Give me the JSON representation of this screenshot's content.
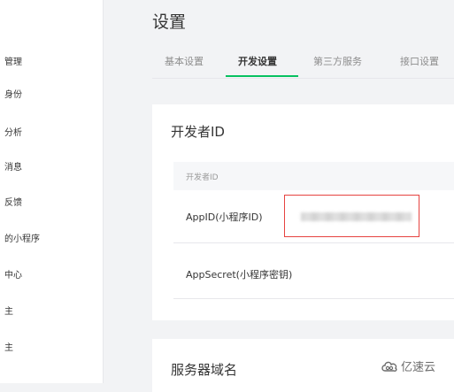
{
  "sidebar": {
    "items": [
      {
        "label": "管理"
      },
      {
        "label": "身份"
      },
      {
        "label": "分析"
      },
      {
        "label": "消息"
      },
      {
        "label": "反馈"
      },
      {
        "label": "的小程序"
      },
      {
        "label": "中心"
      },
      {
        "label": "主"
      },
      {
        "label": "主"
      }
    ]
  },
  "page": {
    "title": "设置"
  },
  "tabs": [
    {
      "label": "基本设置",
      "active": false
    },
    {
      "label": "开发设置",
      "active": true
    },
    {
      "label": "第三方服务",
      "active": false
    },
    {
      "label": "接口设置",
      "active": false
    }
  ],
  "developer_card": {
    "title": "开发者ID",
    "table_header": "开发者ID",
    "rows": [
      {
        "label": "AppID(小程序ID)"
      },
      {
        "label": "AppSecret(小程序密钥)"
      }
    ]
  },
  "server_card": {
    "title": "服务器域名"
  },
  "watermark": {
    "text": "亿速云"
  },
  "colors": {
    "accent": "#07c160",
    "highlight_border": "#e64340"
  }
}
